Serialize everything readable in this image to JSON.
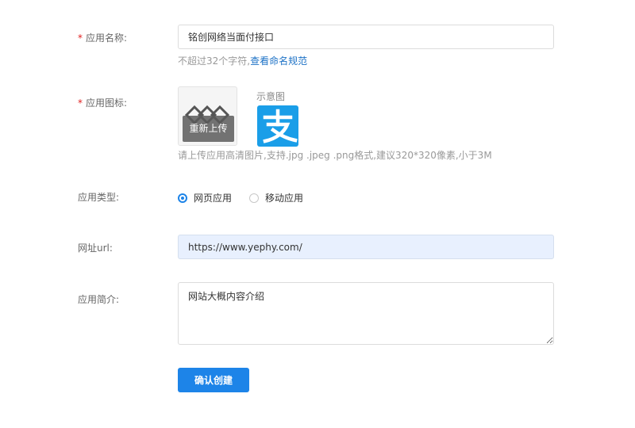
{
  "form": {
    "app_name": {
      "required_mark": "*",
      "label": "应用名称:",
      "value": "铭创网络当面付接口",
      "hint_text": "不超过32个字符,",
      "hint_link": "查看命名规范"
    },
    "app_icon": {
      "required_mark": "*",
      "label": "应用图标:",
      "reupload_label": "重新上传",
      "preview_label": "示意图",
      "preview_icon": "alipay-icon",
      "hint": "请上传应用高清图片,支持.jpg .jpeg .png格式,建议320*320像素,小于3M"
    },
    "app_type": {
      "label": "应用类型:",
      "options": [
        {
          "label": "网页应用",
          "checked": true
        },
        {
          "label": "移动应用",
          "checked": false
        }
      ]
    },
    "url": {
      "label": "网址url:",
      "value": "https://www.yephy.com/"
    },
    "description": {
      "label": "应用简介:",
      "value": "网站大概内容介绍"
    },
    "submit_label": "确认创建"
  },
  "colors": {
    "primary": "#1d84e8",
    "required": "#e02020",
    "link": "#1d72c6",
    "alipay_blue": "#1a9ee8",
    "url_fill": "#e8f0fe"
  }
}
